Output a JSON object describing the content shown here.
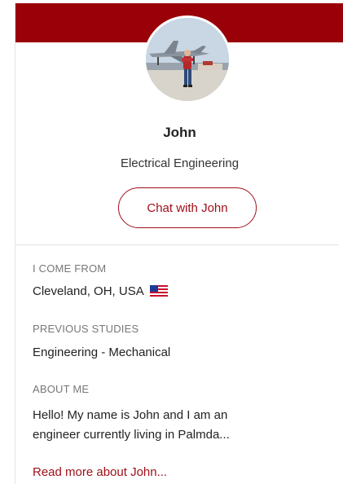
{
  "profile": {
    "name": "John",
    "program": "Electrical Engineering",
    "chat_label": "Chat with John"
  },
  "details": {
    "from_label": "I COME FROM",
    "from_value": "Cleveland, OH, USA",
    "flag_icon": "us-flag-icon",
    "studies_label": "PREVIOUS STUDIES",
    "studies_value": "Engineering - Mechanical",
    "about_label": "ABOUT ME",
    "about_line1": "Hello! My name is John and I am an",
    "about_line2": "engineer currently living in Palmda...",
    "read_more": "Read more about John..."
  },
  "colors": {
    "banner": "#9a0007",
    "accent": "#a0101a"
  }
}
